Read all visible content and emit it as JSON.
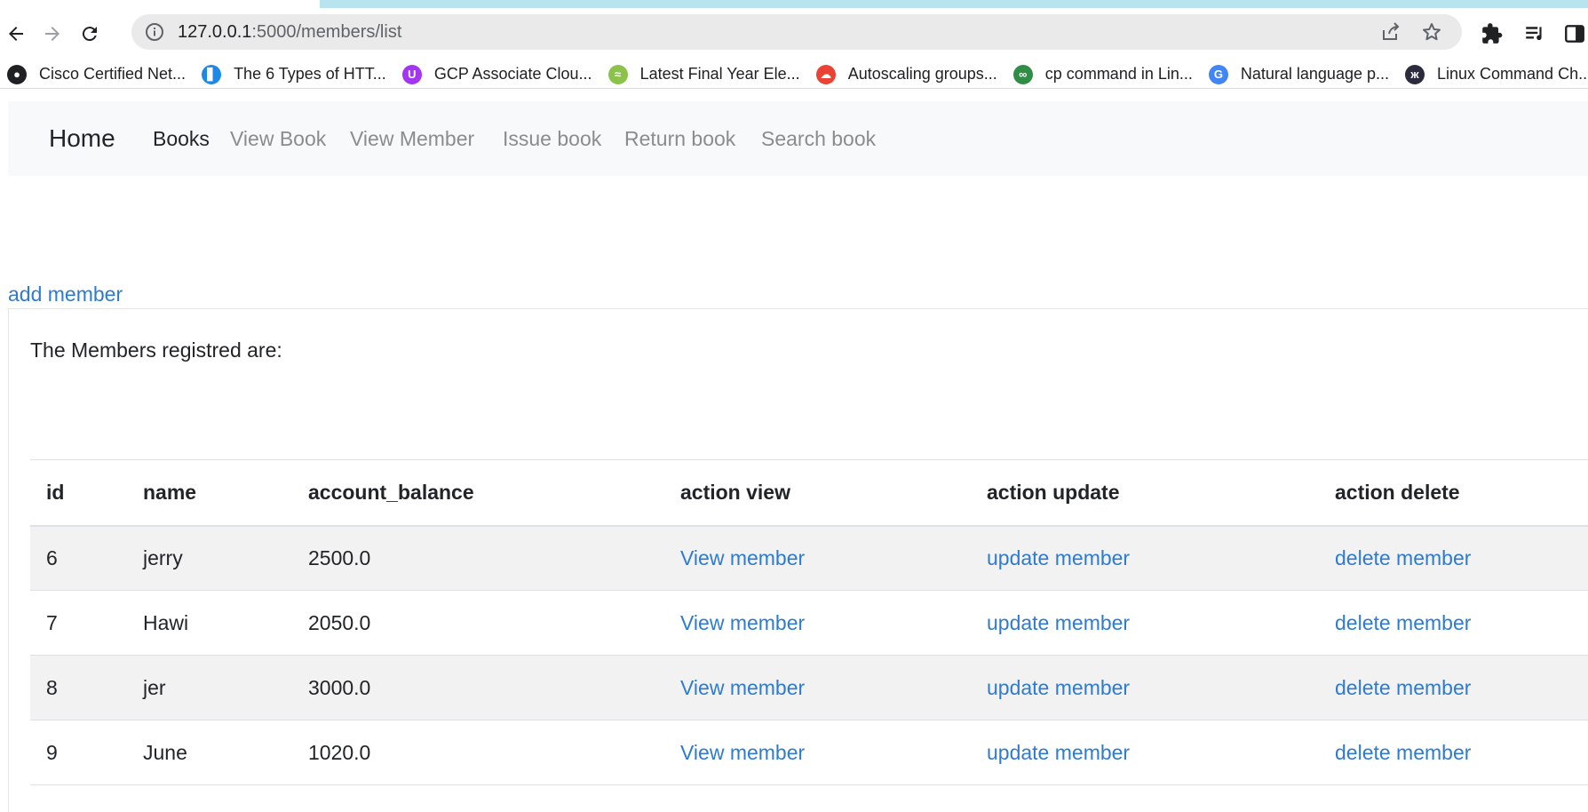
{
  "browser": {
    "url_host": "127.0.0.1",
    "url_path": ":5000/members/list",
    "bookmarks": [
      {
        "label": "Cisco Certified Net...",
        "icon": "globe-icon",
        "color": "#202124"
      },
      {
        "label": "The 6 Types of HTT...",
        "icon": "site-icon",
        "color": "#1e88e5"
      },
      {
        "label": "GCP Associate Clou...",
        "icon": "udemy-icon",
        "color": "#a435f0"
      },
      {
        "label": "Latest Final Year Ele...",
        "icon": "leaf-icon",
        "color": "#8bc34a"
      },
      {
        "label": "Autoscaling groups...",
        "icon": "google-cloud-icon",
        "color": "#ea4335"
      },
      {
        "label": "cp command in Lin...",
        "icon": "geeksforgeeks-icon",
        "color": "#2f8d46"
      },
      {
        "label": "Natural language p...",
        "icon": "google-icon",
        "color": "#4285f4"
      },
      {
        "label": "Linux Command Ch...",
        "icon": "site-dark-icon",
        "color": "#2b2b3d"
      }
    ]
  },
  "navbar": {
    "brand": "Home",
    "links": [
      {
        "label": "Books",
        "active": true
      },
      {
        "label": "View Book"
      },
      {
        "label": "View Member"
      },
      {
        "label": "Issue book"
      },
      {
        "label": "Return book"
      },
      {
        "label": "Search book"
      }
    ]
  },
  "page": {
    "add_member_label": "add member",
    "intro_text": "The Members registred are:"
  },
  "table": {
    "headers": [
      "id",
      "name",
      "account_balance",
      "action view",
      "action update",
      "action delete"
    ],
    "rows": [
      {
        "id": "6",
        "name": "jerry",
        "account_balance": "2500.0",
        "view": "View member",
        "update": "update member",
        "delete": "delete member"
      },
      {
        "id": "7",
        "name": "Hawi",
        "account_balance": "2050.0",
        "view": "View member",
        "update": "update member",
        "delete": "delete member"
      },
      {
        "id": "8",
        "name": "jer",
        "account_balance": "3000.0",
        "view": "View member",
        "update": "update member",
        "delete": "delete member"
      },
      {
        "id": "9",
        "name": "June",
        "account_balance": "1020.0",
        "view": "View member",
        "update": "update member",
        "delete": "delete member"
      }
    ]
  },
  "colors": {
    "link": "#2e7bcf",
    "navbar_bg": "#f8f9fa",
    "striped_row": "#f2f2f2"
  }
}
